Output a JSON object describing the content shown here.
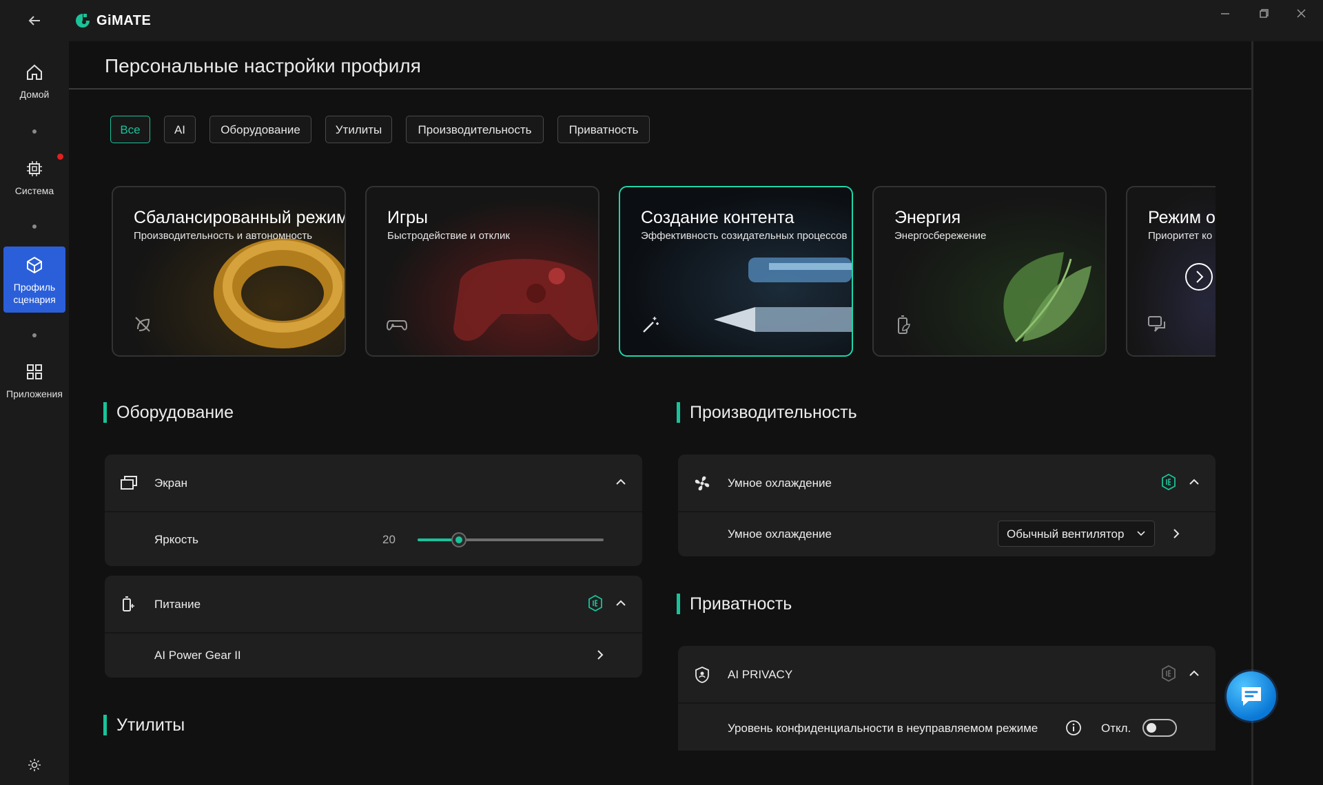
{
  "app": {
    "name": "GiMATE"
  },
  "sidebar": {
    "items": [
      {
        "label": "Домой"
      },
      {
        "label": "Система"
      },
      {
        "label": "Профиль сценария"
      },
      {
        "label": "Приложения"
      }
    ]
  },
  "page": {
    "title": "Персональные настройки профиля"
  },
  "filters": [
    {
      "label": "Все",
      "active": true
    },
    {
      "label": "AI"
    },
    {
      "label": "Оборудование"
    },
    {
      "label": "Утилиты"
    },
    {
      "label": "Производительность"
    },
    {
      "label": "Приватность"
    }
  ],
  "scenarios": [
    {
      "title": "Сбалансированный режим",
      "subtitle": "Производительность и автономность",
      "icon": "leaf-off-icon"
    },
    {
      "title": "Игры",
      "subtitle": "Быстродействие и отклик",
      "icon": "gamepad-icon"
    },
    {
      "title": "Создание контента",
      "subtitle": "Эффективность созидательных процессов",
      "icon": "magic-wand-icon",
      "selected": true
    },
    {
      "title": "Энергия",
      "subtitle": "Энергосбережение",
      "icon": "battery-leaf-icon"
    },
    {
      "title": "Режим о",
      "subtitle": "Приоритет ко",
      "icon": "chat-icon"
    }
  ],
  "sections": {
    "hardware": {
      "title": "Оборудование",
      "screen": {
        "label": "Экран",
        "brightness_label": "Яркость",
        "brightness_value": "20"
      },
      "power": {
        "label": "Питание",
        "item_label": "AI Power Gear II"
      }
    },
    "utilities": {
      "title": "Утилиты"
    },
    "performance": {
      "title": "Производительность",
      "cooling": {
        "label": "Умное охлаждение",
        "item_label": "Умное охлаждение",
        "dropdown_value": "Обычный вентилятор"
      }
    },
    "privacy": {
      "title": "Приватность",
      "ai_privacy": {
        "label": "AI PRIVACY",
        "item_label": "Уровень конфиденциальности в неуправляемом режиме",
        "toggle_state": "Откл."
      }
    }
  },
  "colors": {
    "accent": "#19c39a",
    "nav_active": "#2b5fd9",
    "background": "#111111",
    "panel": "#1f1f1f"
  }
}
